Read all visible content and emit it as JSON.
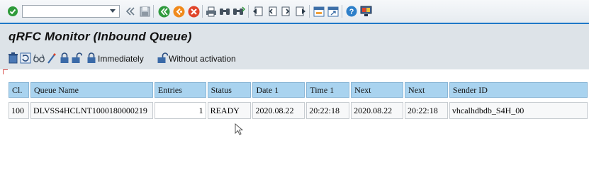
{
  "toolbar": {
    "command_field": {
      "value": "",
      "placeholder": ""
    },
    "icons": [
      "ok-check-icon",
      "dropdown-arrow-icon",
      "history-back-icon",
      "save-icon",
      "back-icon",
      "exit-icon",
      "cancel-icon",
      "print-icon",
      "find-icon",
      "find-next-icon",
      "first-page-icon",
      "previous-page-icon",
      "next-page-icon",
      "last-page-icon",
      "create-session-icon",
      "shortcut-icon",
      "help-icon",
      "customize-layout-icon"
    ]
  },
  "title": "qRFC Monitor (Inbound Queue)",
  "app_toolbar": {
    "icons": [
      "delete-icon",
      "refresh-icon",
      "glasses-icon",
      "wand-icon",
      "lock-icon",
      "unlock-icon"
    ],
    "immediately_label": "Immediately",
    "without_activation_label": "Without activation"
  },
  "table": {
    "columns": [
      "Cl.",
      "Queue Name",
      "Entries",
      "Status",
      "Date 1",
      "Time 1",
      "Next",
      "Next",
      "Sender ID"
    ],
    "rows": [
      [
        "100",
        "DLVSS4HCLNT1000180000219",
        "1",
        "READY",
        "2020.08.22",
        "20:22:18",
        "2020.08.22",
        "20:22:18",
        "vhcalhdbdb_S4H_00"
      ]
    ]
  },
  "colors": {
    "accent": "#1f78c8",
    "header_bg": "#a9d3ef",
    "toolbar_bg": "#dde3e8"
  }
}
